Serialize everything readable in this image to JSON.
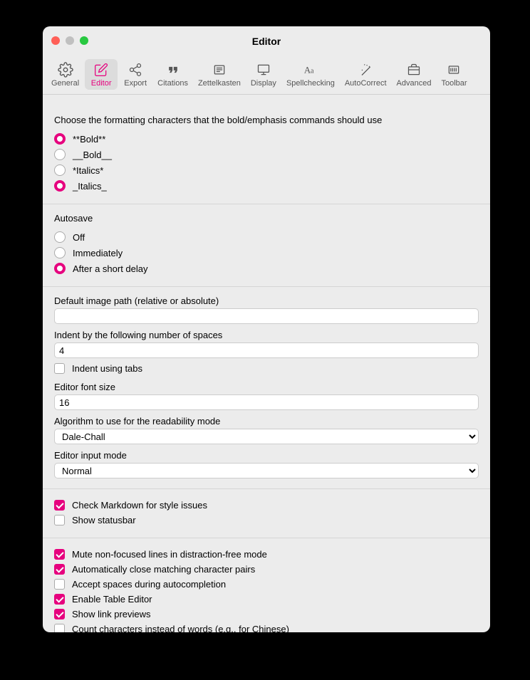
{
  "window": {
    "title": "Editor"
  },
  "toolbar": {
    "tabs": [
      {
        "id": "general",
        "label": "General"
      },
      {
        "id": "editor",
        "label": "Editor"
      },
      {
        "id": "export",
        "label": "Export"
      },
      {
        "id": "citations",
        "label": "Citations"
      },
      {
        "id": "zettelkasten",
        "label": "Zettelkasten"
      },
      {
        "id": "display",
        "label": "Display"
      },
      {
        "id": "spellchecking",
        "label": "Spellchecking"
      },
      {
        "id": "autocorrect",
        "label": "AutoCorrect"
      },
      {
        "id": "advanced",
        "label": "Advanced"
      },
      {
        "id": "toolbar",
        "label": "Toolbar"
      }
    ],
    "active": "editor"
  },
  "formatting": {
    "label": "Choose the formatting characters that the bold/emphasis commands should use",
    "options": [
      {
        "label": "**Bold**",
        "selected": true
      },
      {
        "label": "__Bold__",
        "selected": false
      },
      {
        "label": "*Italics*",
        "selected": false
      },
      {
        "label": "_Italics_",
        "selected": true
      }
    ]
  },
  "autosave": {
    "label": "Autosave",
    "options": [
      {
        "label": "Off",
        "selected": false
      },
      {
        "label": "Immediately",
        "selected": false
      },
      {
        "label": "After a short delay",
        "selected": true
      }
    ]
  },
  "fields": {
    "image_path": {
      "label": "Default image path (relative or absolute)",
      "value": ""
    },
    "indent_spaces": {
      "label": "Indent by the following number of spaces",
      "value": "4"
    },
    "indent_tabs": {
      "label": "Indent using tabs",
      "checked": false
    },
    "font_size": {
      "label": "Editor font size",
      "value": "16"
    },
    "readability": {
      "label": "Algorithm to use for the readability mode",
      "value": "Dale-Chall"
    },
    "input_mode": {
      "label": "Editor input mode",
      "value": "Normal"
    }
  },
  "checks1": [
    {
      "label": "Check Markdown for style issues",
      "checked": true
    },
    {
      "label": "Show statusbar",
      "checked": false
    }
  ],
  "checks2": [
    {
      "label": "Mute non-focused lines in distraction-free mode",
      "checked": true
    },
    {
      "label": "Automatically close matching character pairs",
      "checked": true
    },
    {
      "label": "Accept spaces during autocompletion",
      "checked": false
    },
    {
      "label": "Enable Table Editor",
      "checked": true
    },
    {
      "label": "Show link previews",
      "checked": true
    },
    {
      "label": "Count characters instead of words (e.g., for Chinese)",
      "checked": false
    }
  ]
}
